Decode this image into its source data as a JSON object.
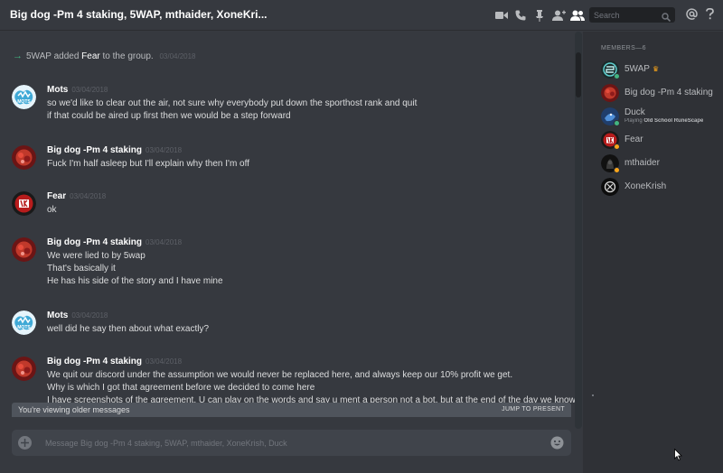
{
  "header": {
    "title": "Big dog -Pm 4 staking, 5WAP, mthaider, XoneKri...",
    "search_placeholder": "Search"
  },
  "system_message": {
    "user": "5WAP",
    "action": "added",
    "target": "Fear",
    "suffix": "to the group.",
    "timestamp": "03/04/2018"
  },
  "messages": [
    {
      "author": "Mots",
      "timestamp": "03/04/2018",
      "lines": [
        "so we'd like to clear out the air, not sure why everybody put down the sporthost rank and quit",
        "if that could be aired up first then we would be a step forward"
      ]
    },
    {
      "author": "Big dog -Pm 4 staking",
      "timestamp": "03/04/2018",
      "lines": [
        "Fuck I'm half asleep but I'll explain why then I'm off"
      ]
    },
    {
      "author": "Fear",
      "timestamp": "03/04/2018",
      "lines": [
        "ok"
      ]
    },
    {
      "author": "Big dog -Pm 4 staking",
      "timestamp": "03/04/2018",
      "lines": [
        "We were lied to by 5wap",
        "That's basically it",
        "He has his side of the story and I have mine"
      ]
    },
    {
      "author": "Mots",
      "timestamp": "03/04/2018",
      "lines": [
        "well did he say then about what exactly?"
      ]
    },
    {
      "author": "Big dog -Pm 4 staking",
      "timestamp": "03/04/2018",
      "lines": [
        "We quit our discord under the assumption we would never be replaced here, and always keep our 10% profit we get.",
        "Why is which I got that agreement before we decided to come here",
        "I have screenshots of the agreement. U can play on the words and say u ment a person not a bot, but at the end of the day we know"
      ]
    }
  ],
  "older_bar": {
    "text": "You're viewing older messages",
    "jump": "JUMP TO PRESENT"
  },
  "composer": {
    "placeholder": "Message Big dog -Pm 4 staking, 5WAP, mthaider, XoneKrish, Duck"
  },
  "members": {
    "heading": "MEMBERS—6",
    "list": [
      {
        "name": "5WAP",
        "status": "online",
        "owner": true,
        "sub": ""
      },
      {
        "name": "Big dog -Pm 4 staking",
        "status": "none",
        "owner": false,
        "sub": ""
      },
      {
        "name": "Duck",
        "status": "online",
        "owner": false,
        "sub_prefix": "Playing",
        "sub": "Old School RuneScape"
      },
      {
        "name": "Fear",
        "status": "idle",
        "owner": false,
        "sub": ""
      },
      {
        "name": "mthaider",
        "status": "idle",
        "owner": false,
        "sub": ""
      },
      {
        "name": "XoneKrish",
        "status": "none",
        "owner": false,
        "sub": ""
      }
    ]
  },
  "colors": {
    "online": "#43b581",
    "idle": "#faa61a",
    "background": "#36393f",
    "sidebar": "#2f3136"
  },
  "icons": [
    "video-call-icon",
    "voice-call-icon",
    "pin-icon",
    "add-member-icon",
    "members-list-icon",
    "search-icon",
    "mention-icon",
    "help-icon",
    "attach-plus-icon",
    "emoji-icon"
  ]
}
